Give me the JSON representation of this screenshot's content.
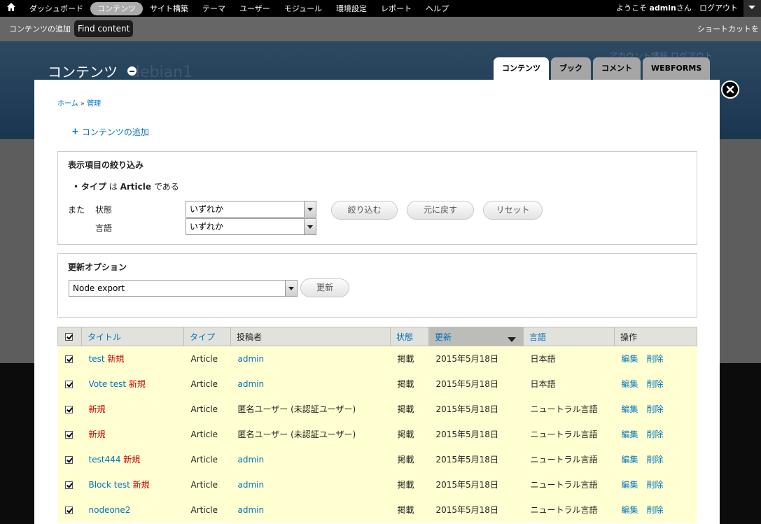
{
  "toolbar": {
    "items": [
      {
        "label": "ダッシュボード",
        "active": false
      },
      {
        "label": "コンテンツ",
        "active": true
      },
      {
        "label": "サイト構築",
        "active": false
      },
      {
        "label": "テーマ",
        "active": false
      },
      {
        "label": "ユーザー",
        "active": false
      },
      {
        "label": "モジュール",
        "active": false
      },
      {
        "label": "環境設定",
        "active": false
      },
      {
        "label": "レポート",
        "active": false
      },
      {
        "label": "ヘルプ",
        "active": false
      }
    ],
    "welcome_prefix": "ようこそ ",
    "username": "admin",
    "welcome_suffix": "さん",
    "logout": "ログアウト"
  },
  "shortcuts": {
    "add_content": "コンテンツの追加",
    "find_content": "Find content",
    "edit_shortcuts": "ショートカットを編集"
  },
  "background": {
    "account_links": "アカウント情報 ログアウト",
    "site_name": "debian1"
  },
  "overlay": {
    "title": "コンテンツ",
    "tabs": [
      "コンテンツ",
      "ブック",
      "コメント",
      "WEBFORMS"
    ],
    "breadcrumb": {
      "home": "ホーム",
      "sep": " » ",
      "admin": "管理"
    },
    "add_content_link": "コンテンツの追加"
  },
  "filter": {
    "legend": "表示項目の絞り込み",
    "condition_type": "タイプ",
    "condition_is": "は",
    "condition_value": "Article",
    "condition_suffix": "である",
    "also": "また",
    "status_label": "状態",
    "status_value": "いずれか",
    "language_label": "言語",
    "language_value": "いずれか",
    "filter_button": "絞り込む",
    "undo_button": "元に戻す",
    "reset_button": "リセット"
  },
  "update_options": {
    "legend": "更新オプション",
    "selected": "Node export",
    "button": "更新"
  },
  "table": {
    "headers": {
      "title": "タイトル",
      "type": "タイプ",
      "author": "投稿者",
      "status": "状態",
      "updated": "更新",
      "language": "言語",
      "operations": "操作"
    },
    "new_marker": "新規",
    "edit_label": "編集",
    "delete_label": "削除",
    "rows": [
      {
        "title": "test",
        "type": "Article",
        "author": "admin",
        "author_link": true,
        "status": "掲載",
        "updated": "2015年5月18日",
        "language": "日本語"
      },
      {
        "title": "Vote test",
        "type": "Article",
        "author": "admin",
        "author_link": true,
        "status": "掲載",
        "updated": "2015年5月18日",
        "language": "日本語"
      },
      {
        "title": "",
        "type": "Article",
        "author": "匿名ユーザー (未認証ユーザー)",
        "author_link": false,
        "status": "掲載",
        "updated": "2015年5月18日",
        "language": "ニュートラル言語"
      },
      {
        "title": "",
        "type": "Article",
        "author": "匿名ユーザー (未認証ユーザー)",
        "author_link": false,
        "status": "掲載",
        "updated": "2015年5月18日",
        "language": "ニュートラル言語"
      },
      {
        "title": "test444",
        "type": "Article",
        "author": "admin",
        "author_link": true,
        "status": "掲載",
        "updated": "2015年5月18日",
        "language": "ニュートラル言語"
      },
      {
        "title": "Block test",
        "type": "Article",
        "author": "admin",
        "author_link": true,
        "status": "掲載",
        "updated": "2015年5月18日",
        "language": "ニュートラル言語"
      },
      {
        "title": "nodeone2",
        "type": "Article",
        "author": "admin",
        "author_link": true,
        "status": "掲載",
        "updated": "2015年5月18日",
        "language": "ニュートラル言語",
        "no_new": true
      }
    ]
  }
}
